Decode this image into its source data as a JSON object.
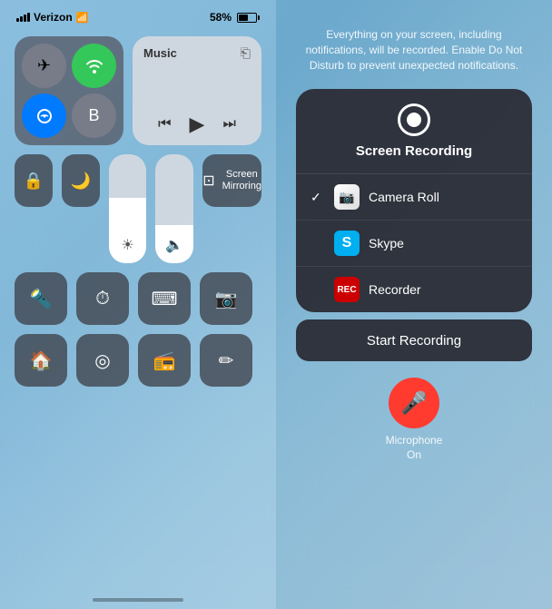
{
  "statusBar": {
    "carrier": "Verizon",
    "battery": "58%",
    "wifiSymbol": "📶"
  },
  "leftPanel": {
    "connectivity": {
      "airplane": "✈",
      "wifi_waves": "((·))",
      "wifi_label": "wifi",
      "bluetooth": "Ᵽ",
      "cellular": "●"
    },
    "music": {
      "label": "Music",
      "airplay": "⬛",
      "prev": "«",
      "play": "▶",
      "next": "»"
    },
    "screenMirroring": {
      "label": "Screen\nMirroring",
      "icon": "⊡"
    },
    "row3": [
      "🔦",
      "⏱",
      "⌨",
      "📷"
    ],
    "row4": [
      "🏠",
      "◎",
      "📻",
      "✏"
    ]
  },
  "rightPanel": {
    "infoText": "Everything on your screen, including notifications, will be recorded. Enable Do Not Disturb to prevent unexpected notifications.",
    "popup": {
      "title": "Screen Recording",
      "items": [
        {
          "id": "camera-roll",
          "label": "Camera Roll",
          "checked": true
        },
        {
          "id": "skype",
          "label": "Skype",
          "checked": false
        },
        {
          "id": "recorder",
          "label": "Recorder",
          "checked": false
        }
      ],
      "startButton": "Start Recording"
    },
    "microphone": {
      "label": "Microphone\nOn"
    }
  }
}
